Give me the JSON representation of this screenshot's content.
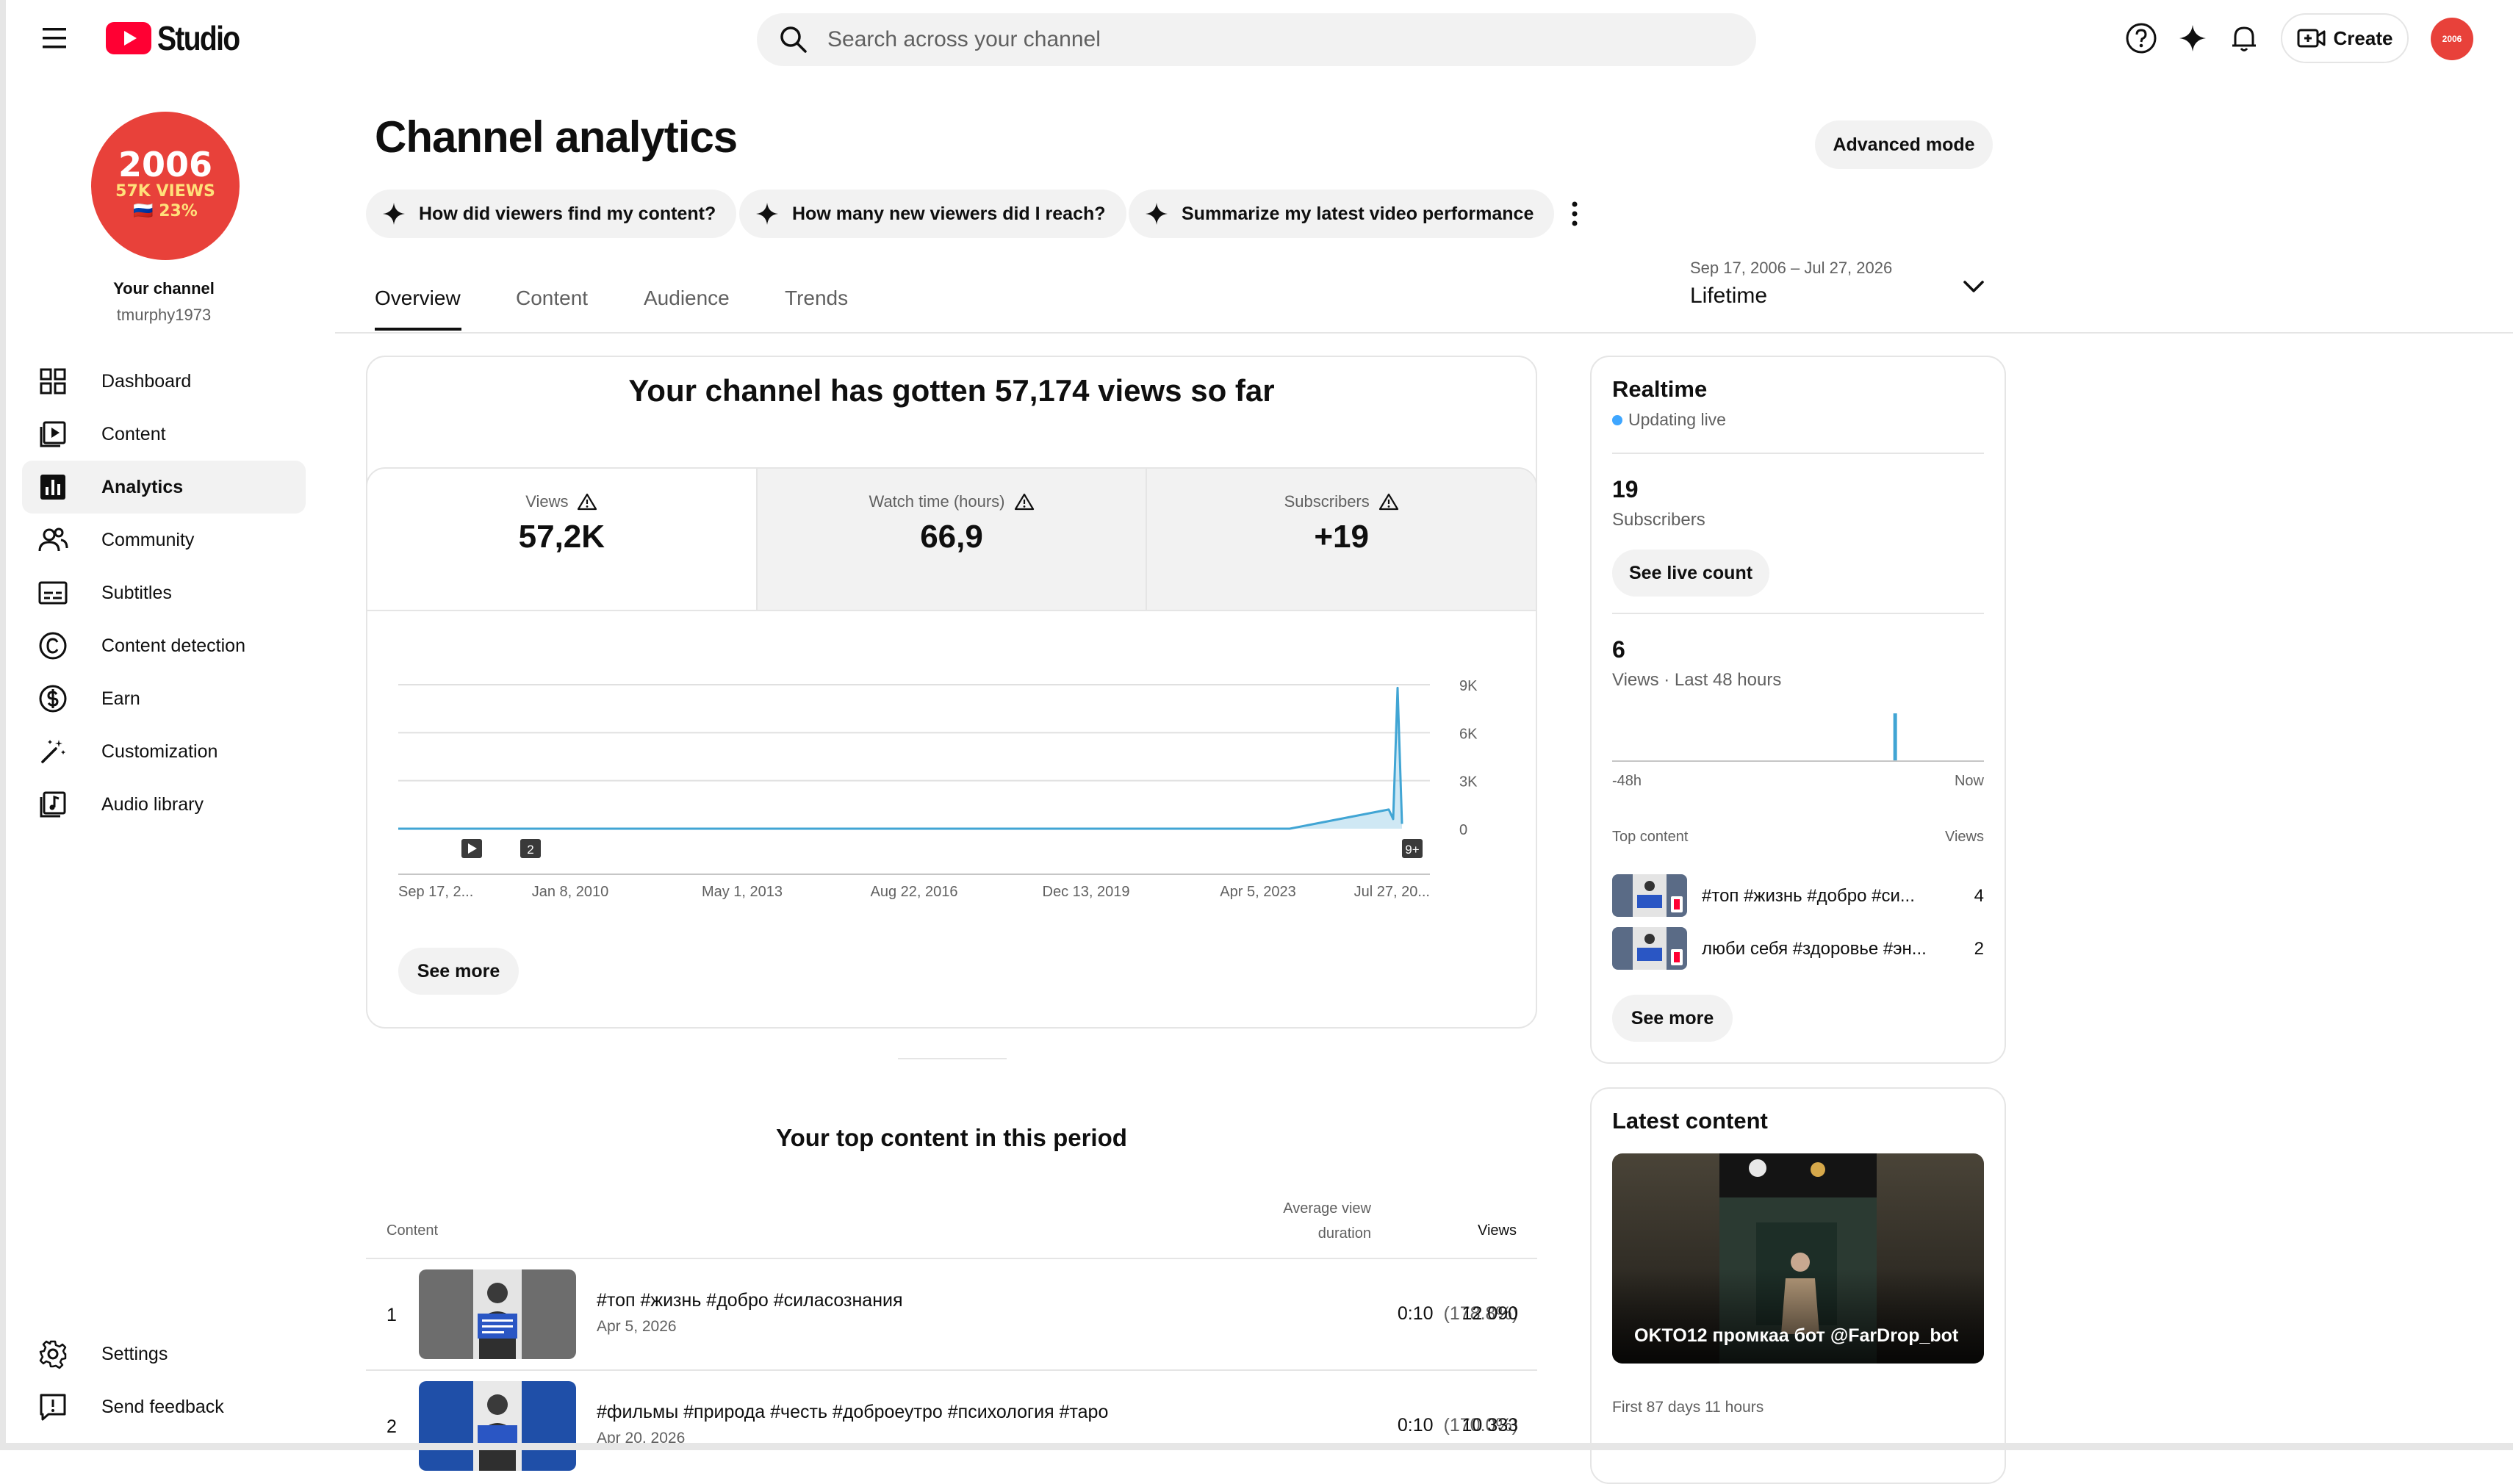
{
  "app": {
    "logo_text": "Studio",
    "search_placeholder": "Search across your channel",
    "create_label": "Create",
    "avatar_text": "2006"
  },
  "channel": {
    "avatar_line1": "2006",
    "avatar_line2": "57K VIEWS",
    "avatar_line3": "🇷🇺 23%",
    "label": "Your channel",
    "handle": "tmurphy1973"
  },
  "sidebar": {
    "items": [
      {
        "label": "Dashboard",
        "icon": "dashboard-icon"
      },
      {
        "label": "Content",
        "icon": "content-icon"
      },
      {
        "label": "Analytics",
        "icon": "analytics-icon",
        "active": true
      },
      {
        "label": "Community",
        "icon": "community-icon"
      },
      {
        "label": "Subtitles",
        "icon": "subtitles-icon"
      },
      {
        "label": "Content detection",
        "icon": "copyright-icon"
      },
      {
        "label": "Earn",
        "icon": "earn-icon"
      },
      {
        "label": "Customization",
        "icon": "magic-wand-icon"
      },
      {
        "label": "Audio library",
        "icon": "audio-library-icon"
      }
    ],
    "settings_label": "Settings",
    "feedback_label": "Send feedback"
  },
  "header": {
    "title": "Channel analytics",
    "advanced_mode": "Advanced mode",
    "chips": [
      "How did viewers find my content?",
      "How many new viewers did I reach?",
      "Summarize my latest video performance"
    ],
    "tabs": [
      "Overview",
      "Content",
      "Audience",
      "Trends"
    ],
    "active_tab": "Overview",
    "date_range": "Sep 17, 2006 – Jul 27, 2026",
    "period": "Lifetime"
  },
  "overview": {
    "summary": "Your channel has gotten 57,174 views so far",
    "metrics": [
      {
        "label": "Views",
        "value": "57,2K",
        "selected": true
      },
      {
        "label": "Watch time (hours)",
        "value": "66,9"
      },
      {
        "label": "Subscribers",
        "value": "+19"
      }
    ],
    "see_more": "See more"
  },
  "chart_data": {
    "type": "line",
    "series": [
      {
        "values": [
          0,
          0,
          0,
          0,
          0,
          0,
          0,
          0,
          0,
          0,
          1200,
          600,
          8800,
          300
        ]
      }
    ],
    "x_tick_labels": [
      "Sep 17, 2...",
      "Jan 8, 2010",
      "May 1, 2013",
      "Aug 22, 2016",
      "Dec 13, 2019",
      "Apr 5, 2023",
      "Jul 27, 20..."
    ],
    "y_tick_labels": [
      "9K",
      "6K",
      "3K",
      "0"
    ],
    "ylim": [
      0,
      9000
    ],
    "color": "#41a5d4",
    "grid": true,
    "markers": [
      {
        "label": "",
        "icon": "play-icon"
      },
      {
        "label": "2"
      },
      {
        "label": "9+"
      }
    ]
  },
  "top_content": {
    "title": "Your top content in this period",
    "headers": {
      "content": "Content",
      "avd_line1": "Average view",
      "avd_line2": "duration",
      "views": "Views"
    },
    "rows": [
      {
        "rank": "1",
        "title": "#топ #жизнь #добро #силасознания",
        "date": "Apr 5, 2026",
        "avd": "0:10",
        "avd_pct": "(178.8%)",
        "views": "12 090"
      },
      {
        "rank": "2",
        "title": "#фильмы #природа #честь #доброеутро #психология #таро",
        "date": "Apr 20, 2026",
        "avd": "0:10",
        "avd_pct": "(170.0%)",
        "views": "10 333"
      }
    ]
  },
  "realtime": {
    "title": "Realtime",
    "status": "Updating live",
    "subscribers_value": "19",
    "subscribers_label": "Subscribers",
    "live_count_btn": "See live count",
    "views_value": "6",
    "views_label": "Views · Last 48 hours",
    "bars_48h": [
      0,
      0,
      0,
      0,
      0,
      0,
      0,
      0,
      0,
      0,
      0,
      0,
      0,
      0,
      0,
      0,
      0,
      0,
      0,
      0,
      0,
      0,
      0,
      0,
      0,
      0,
      0,
      0,
      0,
      0,
      0,
      0,
      0,
      0,
      0,
      0,
      6,
      0,
      0,
      0,
      0,
      0,
      0,
      0,
      0,
      0,
      0,
      0
    ],
    "axis_left": "-48h",
    "axis_right": "Now",
    "top_content_label": "Top content",
    "views_col_label": "Views",
    "items": [
      {
        "title": "#топ #жизнь #добро #си...",
        "views": "4"
      },
      {
        "title": "люби себя #здоровье #эн...",
        "views": "2"
      }
    ],
    "see_more": "See more"
  },
  "latest": {
    "title": "Latest content",
    "video_title": "OKTO12 промкаа бот @FarDrop_bot",
    "meta": "First 87 days 11 hours"
  },
  "colors": {
    "accent_blue": "#41a5d4",
    "brand_red": "#ff0033",
    "avatar_red": "#e8413a"
  }
}
